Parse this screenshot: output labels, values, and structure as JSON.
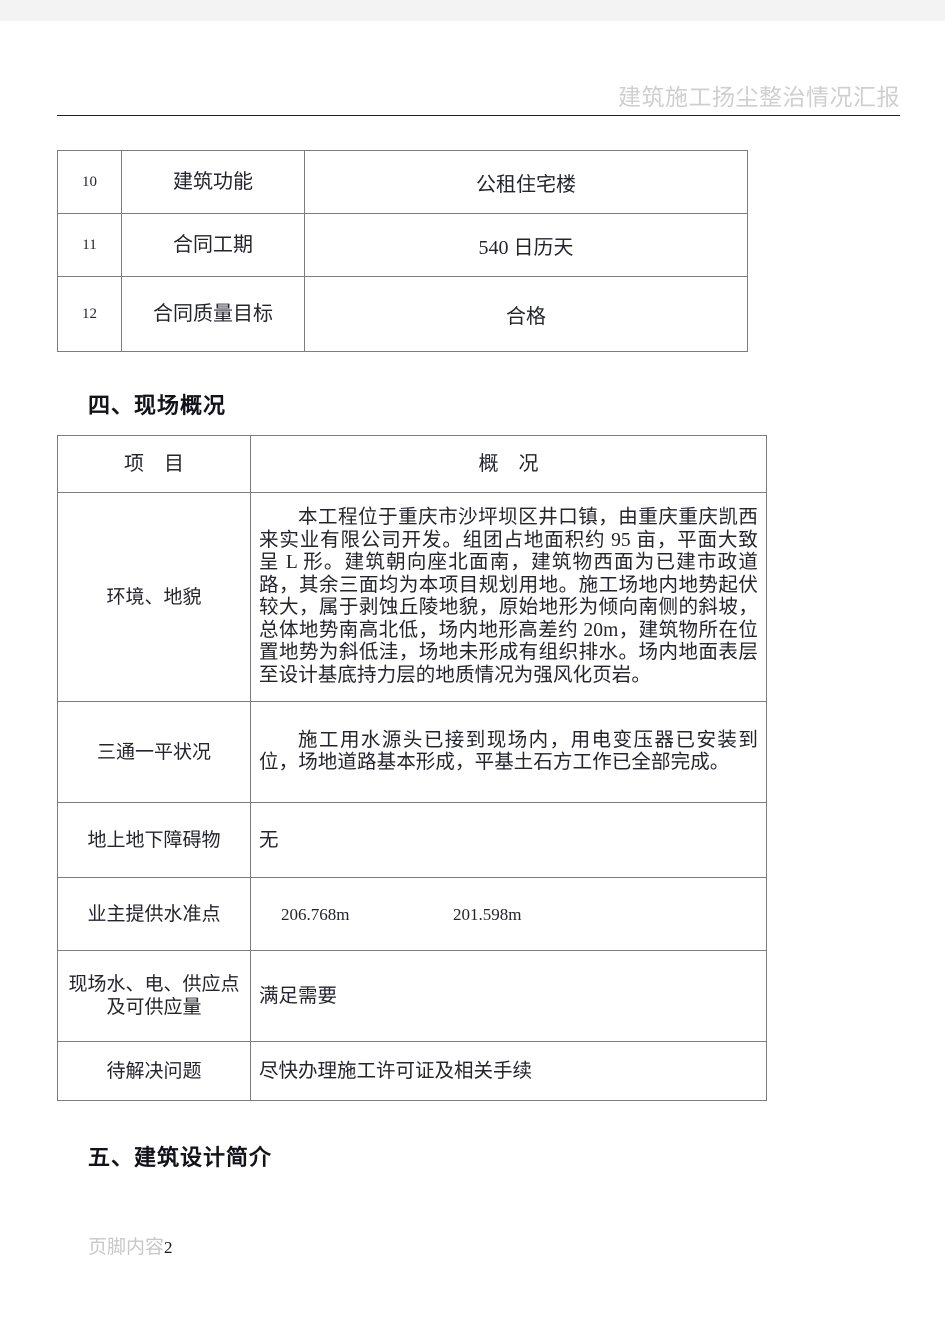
{
  "header": {
    "running_title": "建筑施工扬尘整治情况汇报"
  },
  "top_table": {
    "rows": [
      {
        "no": "10",
        "item": "建筑功能",
        "value": "公租住宅楼"
      },
      {
        "no": "11",
        "item": "合同工期",
        "value": "540 日历天"
      },
      {
        "no": "12",
        "item": "合同质量目标",
        "value": "合格"
      }
    ]
  },
  "sections": {
    "four": "四、现场概况",
    "five": "五、建筑设计简介"
  },
  "overview_table": {
    "headers": {
      "item": "项　目",
      "desc": "概　况"
    },
    "rows": [
      {
        "item": "环境、地貌",
        "desc": "本工程位于重庆市沙坪坝区井口镇，由重庆重庆凯西来实业有限公司开发。组团占地面积约 95 亩，平面大致呈 L 形。建筑朝向座北面南，建筑物西面为已建市政道路，其余三面均为本项目规划用地。施工场地内地势起伏较大，属于剥蚀丘陵地貌，原始地形为倾向南侧的斜坡，总体地势南高北低，场内地形高差约 20m，建筑物所在位置地势为斜低洼，场地未形成有组织排水。场内地面表层至设计基底持力层的地质情况为强风化页岩。"
      },
      {
        "item": "三通一平状况",
        "desc": "施工用水源头已接到现场内，用电变压器已安装到位，场地道路基本形成，平基土石方工作已全部完成。"
      },
      {
        "item": "地上地下障碍物",
        "desc": "无"
      },
      {
        "item": "业主提供水准点",
        "desc_value_1": "206.768m",
        "desc_value_2": "201.598m"
      },
      {
        "item": "现场水、电、供应点及可供应量",
        "desc": "满足需要"
      },
      {
        "item": "待解决问题",
        "desc": "尽快办理施工许可证及相关手续"
      }
    ]
  },
  "footer": {
    "text": "页脚内容",
    "page_number": "2"
  }
}
